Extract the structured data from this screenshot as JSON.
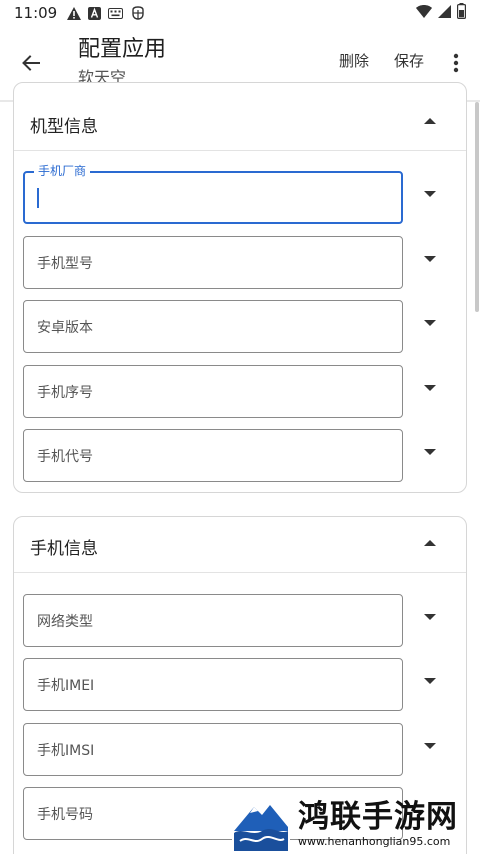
{
  "status_bar": {
    "time": "11:09",
    "icons": [
      "warning-icon",
      "app-a-icon",
      "keyboard-icon",
      "bug-icon",
      "wifi-icon",
      "signal-icon",
      "battery-icon"
    ]
  },
  "app_bar": {
    "title": "配置应用",
    "subtitle": "软天空",
    "actions": {
      "delete": "删除",
      "save": "保存"
    }
  },
  "sections": [
    {
      "title": "机型信息",
      "expanded": true,
      "fields": [
        {
          "label": "手机厂商",
          "value": "",
          "focused": true
        },
        {
          "label": "手机型号",
          "value": ""
        },
        {
          "label": "安卓版本",
          "value": ""
        },
        {
          "label": "手机序号",
          "value": ""
        },
        {
          "label": "手机代号",
          "value": ""
        }
      ]
    },
    {
      "title": "手机信息",
      "expanded": true,
      "fields": [
        {
          "label": "网络类型",
          "value": ""
        },
        {
          "label": "手机IMEI",
          "value": ""
        },
        {
          "label": "手机IMSI",
          "value": ""
        },
        {
          "label": "手机号码",
          "value": ""
        }
      ]
    }
  ],
  "watermark": {
    "name": "鸿联手游网",
    "url": "www.henanhonglian95.com"
  },
  "colors": {
    "accent": "#2a6ad1",
    "outline": "#8a8a8a",
    "card_border": "#d6d6d6"
  }
}
